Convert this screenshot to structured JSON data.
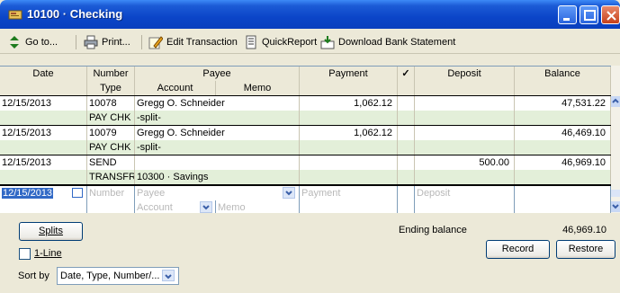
{
  "window": {
    "title": "10100 · Checking"
  },
  "toolbar": {
    "goto": "Go to...",
    "print": "Print...",
    "edit_transaction": "Edit Transaction",
    "quickreport": "QuickReport",
    "download": "Download Bank Statement"
  },
  "columns": {
    "date": "Date",
    "number": "Number",
    "type": "Type",
    "payee": "Payee",
    "account": "Account",
    "memo": "Memo",
    "payment": "Payment",
    "check": "✓",
    "deposit": "Deposit",
    "balance": "Balance"
  },
  "transactions": [
    {
      "date": "12/15/2013",
      "number": "10078",
      "type": "PAY CHK",
      "payee": "Gregg O. Schneider",
      "account": "-split-",
      "memo": "",
      "payment": "1,062.12",
      "deposit": "",
      "balance": "47,531.22"
    },
    {
      "date": "12/15/2013",
      "number": "10079",
      "type": "PAY CHK",
      "payee": "Gregg O. Schneider",
      "account": "-split-",
      "memo": "",
      "payment": "1,062.12",
      "deposit": "",
      "balance": "46,469.10"
    },
    {
      "date": "12/15/2013",
      "number": "SEND",
      "type": "TRANSFR",
      "payee": "",
      "account": "10300 · Savings",
      "memo": "",
      "payment": "",
      "deposit": "500.00",
      "balance": "46,969.10"
    }
  ],
  "entry": {
    "date": "12/15/2013",
    "number_placeholder": "Number",
    "payee_placeholder": "Payee",
    "account_placeholder": "Account",
    "memo_placeholder": "Memo",
    "payment_placeholder": "Payment",
    "deposit_placeholder": "Deposit"
  },
  "footer": {
    "splits": "Splits",
    "ending_balance_label": "Ending balance",
    "ending_balance_value": "46,969.10",
    "one_line": "1-Line",
    "sort_by": "Sort by",
    "sort_value": "Date, Type, Number/...",
    "record": "Record",
    "restore": "Restore"
  }
}
